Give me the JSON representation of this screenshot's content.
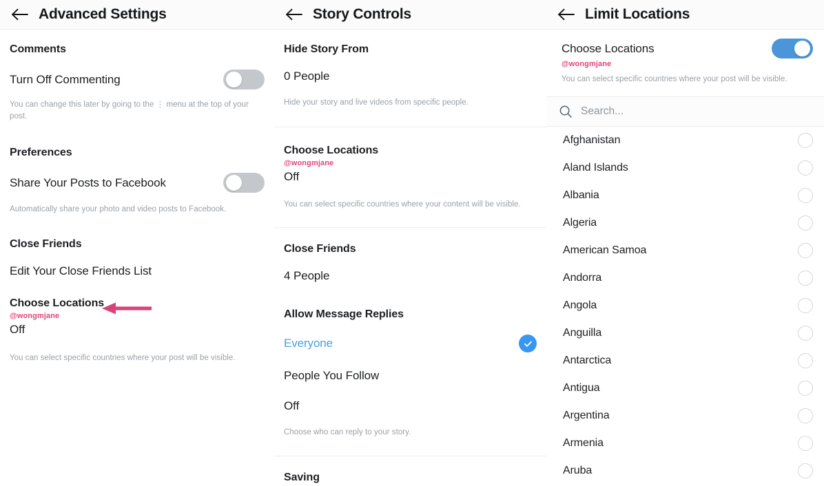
{
  "theme": {
    "accent_pink": "#e0457b",
    "toggle_on": "#4a96d8",
    "toggle_off": "#c4c7cb",
    "check_blue": "#3897f0",
    "link_blue": "#4a9fe0"
  },
  "panels": {
    "left": {
      "header": {
        "title": "Advanced Settings",
        "back_icon": "back-arrow-icon"
      },
      "sections": [
        {
          "title": "Comments",
          "row_label": "Turn Off Commenting",
          "toggle_state": "off",
          "hint": "You can change this later by going to the ⋮ menu at the top of your post."
        },
        {
          "title": "Preferences",
          "row_label": "Share Your Posts to Facebook",
          "toggle_state": "off",
          "hint": "Automatically share your photo and video posts to Facebook."
        },
        {
          "title": "Close Friends",
          "row_label": "Edit Your Close Friends List"
        },
        {
          "title": "Choose Locations",
          "handle": "@wongmjane",
          "value": "Off",
          "hint": "You can select specific countries where your post will be visible.",
          "annotation": "pink-arrow-icon"
        }
      ]
    },
    "middle": {
      "header": {
        "title": "Story Controls",
        "back_icon": "back-arrow-icon"
      },
      "sections": [
        {
          "title": "Hide Story From",
          "value": "0 People",
          "hint": "Hide your story and live videos from specific people."
        },
        {
          "title": "Choose Locations",
          "handle": "@wongmjane",
          "value": "Off",
          "hint": "You can select specific countries where your content will be visible.",
          "annotation": "pink-arrow-icon"
        },
        {
          "title": "Close Friends",
          "value": "4 People"
        },
        {
          "title": "Allow Message Replies",
          "options": [
            {
              "label": "Everyone",
              "selected": true
            },
            {
              "label": "People You Follow",
              "selected": false
            },
            {
              "label": "Off",
              "selected": false
            }
          ],
          "hint": "Choose who can reply to your story."
        },
        {
          "title": "Saving"
        }
      ]
    },
    "right": {
      "header": {
        "title": "Limit Locations",
        "back_icon": "back-arrow-icon"
      },
      "choose_locations": {
        "label": "Choose Locations",
        "handle": "@wongmjane",
        "hint": "You can select specific countries where your post will be visible.",
        "toggle_state": "on"
      },
      "search": {
        "placeholder": "Search...",
        "value": "",
        "icon": "search-icon"
      },
      "countries": [
        {
          "name": "Afghanistan",
          "selected": false
        },
        {
          "name": "Aland Islands",
          "selected": false
        },
        {
          "name": "Albania",
          "selected": false
        },
        {
          "name": "Algeria",
          "selected": false
        },
        {
          "name": "American Samoa",
          "selected": false
        },
        {
          "name": "Andorra",
          "selected": false
        },
        {
          "name": "Angola",
          "selected": false
        },
        {
          "name": "Anguilla",
          "selected": false
        },
        {
          "name": "Antarctica",
          "selected": false
        },
        {
          "name": "Antigua",
          "selected": false
        },
        {
          "name": "Argentina",
          "selected": false
        },
        {
          "name": "Armenia",
          "selected": false
        },
        {
          "name": "Aruba",
          "selected": false
        }
      ]
    }
  }
}
